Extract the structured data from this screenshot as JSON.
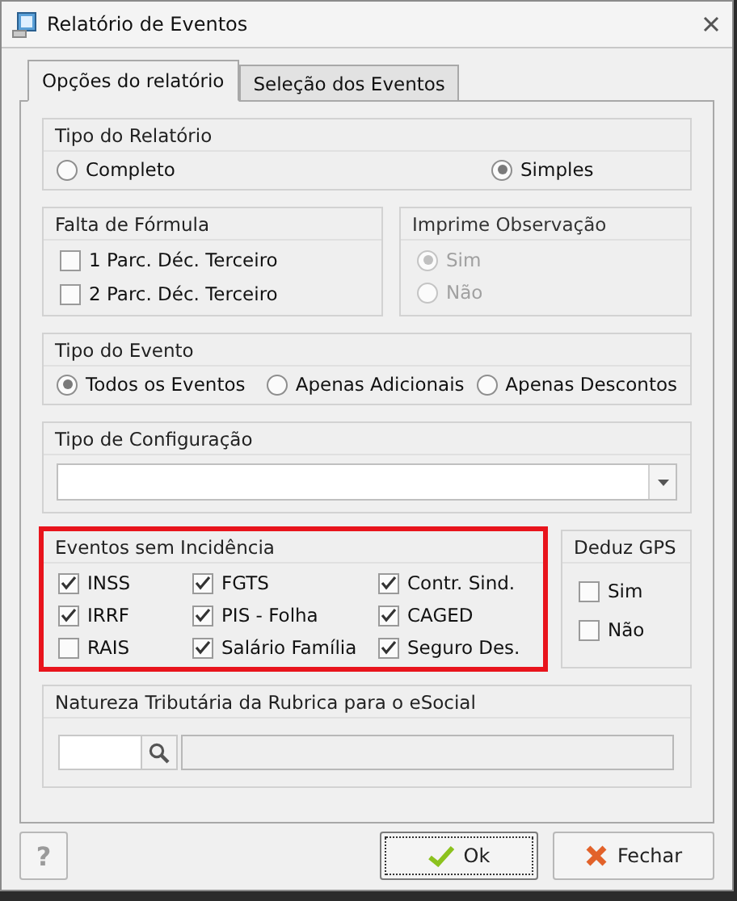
{
  "window": {
    "title": "Relatório de Eventos"
  },
  "tabs": [
    {
      "label": "Opções do relatório",
      "selected": true
    },
    {
      "label": "Seleção dos Eventos",
      "selected": false
    }
  ],
  "tipo_relatorio": {
    "title": "Tipo do Relatório",
    "options": [
      {
        "label": "Completo",
        "selected": false
      },
      {
        "label": "Simples",
        "selected": true
      }
    ]
  },
  "falta_formula": {
    "title": "Falta de Fórmula",
    "items": [
      {
        "label": "1 Parc. Déc. Terceiro",
        "checked": false
      },
      {
        "label": "2 Parc. Déc. Terceiro",
        "checked": false
      }
    ]
  },
  "imprime_observacao": {
    "title": "Imprime Observação",
    "disabled": true,
    "options": [
      {
        "label": "Sim",
        "selected": true
      },
      {
        "label": "Não",
        "selected": false
      }
    ]
  },
  "tipo_evento": {
    "title": "Tipo do Evento",
    "options": [
      {
        "label": "Todos os Eventos",
        "selected": true
      },
      {
        "label": "Apenas Adicionais",
        "selected": false
      },
      {
        "label": "Apenas Descontos",
        "selected": false
      }
    ]
  },
  "tipo_configuracao": {
    "title": "Tipo de Configuração"
  },
  "eventos_sem_incidencia": {
    "title": "Eventos sem Incidência",
    "highlighted": true,
    "items": [
      {
        "label": "INSS",
        "checked": true
      },
      {
        "label": "FGTS",
        "checked": true
      },
      {
        "label": "Contr. Sind.",
        "checked": true
      },
      {
        "label": "IRRF",
        "checked": true
      },
      {
        "label": "PIS - Folha",
        "checked": true
      },
      {
        "label": "CAGED",
        "checked": true
      },
      {
        "label": "RAIS",
        "checked": false
      },
      {
        "label": "Salário Família",
        "checked": true
      },
      {
        "label": "Seguro Des.",
        "checked": true
      }
    ]
  },
  "deduz_gps": {
    "title": "Deduz GPS",
    "items": [
      {
        "label": "Sim",
        "checked": false
      },
      {
        "label": "Não",
        "checked": false
      }
    ]
  },
  "natureza": {
    "title": "Natureza Tributária da Rubrica para o eSocial"
  },
  "buttons": {
    "help": "?",
    "ok": "Ok",
    "close": "Fechar"
  }
}
